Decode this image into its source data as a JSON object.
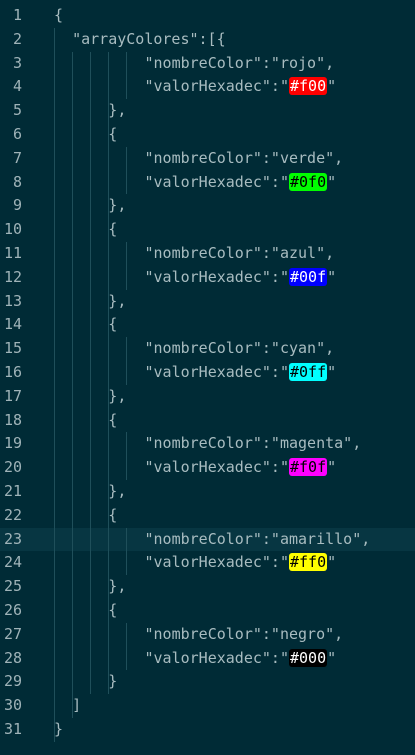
{
  "editor": {
    "colors": {
      "background": "#002b36",
      "active_line": "#073642",
      "text": "#a8bcc0",
      "line_number": "#9fb3b8",
      "indent_guide": "#1f4f5a"
    },
    "lines": [
      {
        "number": "1",
        "text": "{"
      },
      {
        "number": "2",
        "text": "\"arrayColores\":[{"
      },
      {
        "number": "3",
        "text": "\"nombreColor\":\"rojo\","
      },
      {
        "number": "4",
        "key": "\"valorHexadec\":\"",
        "swatch": "#f00",
        "swatch_bg": "#ff0000",
        "swatch_fg": "#ffffff",
        "tail": "\""
      },
      {
        "number": "5",
        "text": "},"
      },
      {
        "number": "6",
        "text": "{"
      },
      {
        "number": "7",
        "text": "\"nombreColor\":\"verde\","
      },
      {
        "number": "8",
        "key": "\"valorHexadec\":\"",
        "swatch": "#0f0",
        "swatch_bg": "#00ff00",
        "swatch_fg": "#000000",
        "tail": "\""
      },
      {
        "number": "9",
        "text": "},"
      },
      {
        "number": "10",
        "text": "{"
      },
      {
        "number": "11",
        "text": "\"nombreColor\":\"azul\","
      },
      {
        "number": "12",
        "key": "\"valorHexadec\":\"",
        "swatch": "#00f",
        "swatch_bg": "#0000ff",
        "swatch_fg": "#ffffff",
        "tail": "\""
      },
      {
        "number": "13",
        "text": "},"
      },
      {
        "number": "14",
        "text": "{"
      },
      {
        "number": "15",
        "text": "\"nombreColor\":\"cyan\","
      },
      {
        "number": "16",
        "key": "\"valorHexadec\":\"",
        "swatch": "#0ff",
        "swatch_bg": "#00ffff",
        "swatch_fg": "#000000",
        "tail": "\""
      },
      {
        "number": "17",
        "text": "},"
      },
      {
        "number": "18",
        "text": "{"
      },
      {
        "number": "19",
        "text": "\"nombreColor\":\"magenta\","
      },
      {
        "number": "20",
        "key": "\"valorHexadec\":\"",
        "swatch": "#f0f",
        "swatch_bg": "#ff00ff",
        "swatch_fg": "#000000",
        "tail": "\""
      },
      {
        "number": "21",
        "text": "},"
      },
      {
        "number": "22",
        "text": "{"
      },
      {
        "number": "23",
        "text": "\"nombreColor\":\"amarillo\","
      },
      {
        "number": "24",
        "key": "\"valorHexadec\":\"",
        "swatch": "#ff0",
        "swatch_bg": "#ffff00",
        "swatch_fg": "#000000",
        "tail": "\""
      },
      {
        "number": "25",
        "text": "},"
      },
      {
        "number": "26",
        "text": "{"
      },
      {
        "number": "27",
        "text": "\"nombreColor\":\"negro\","
      },
      {
        "number": "28",
        "key": "\"valorHexadec\":\"",
        "swatch": "#000",
        "swatch_bg": "#000000",
        "swatch_fg": "#ffffff",
        "tail": "\""
      },
      {
        "number": "29",
        "text": "}"
      },
      {
        "number": "30",
        "text": "]"
      },
      {
        "number": "31",
        "text": "}"
      }
    ]
  }
}
